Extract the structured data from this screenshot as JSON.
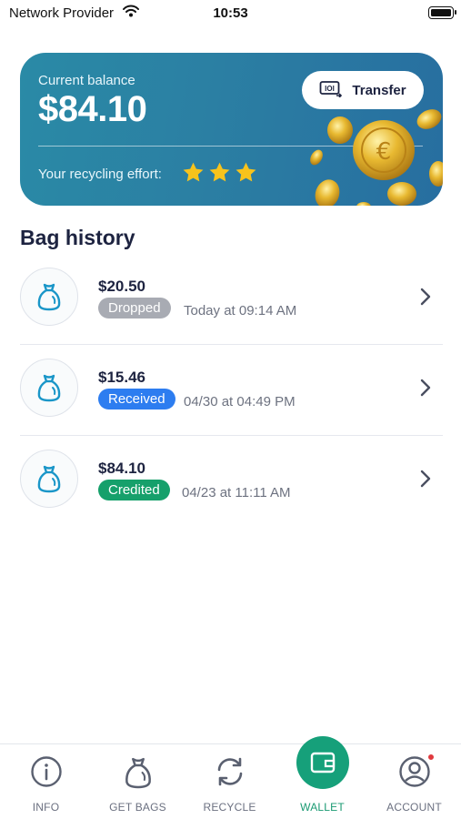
{
  "status_bar": {
    "carrier": "Network Provider",
    "time": "10:53"
  },
  "balance_card": {
    "label": "Current balance",
    "amount": "$84.10",
    "transfer_label": "Transfer",
    "effort_label": "Your recycling effort:",
    "effort_stars": 3
  },
  "history": {
    "title": "Bag history",
    "items": [
      {
        "amount": "$20.50",
        "status": "Dropped",
        "status_color": "#a8abb3",
        "date": "Today at 09:14 AM"
      },
      {
        "amount": "$15.46",
        "status": "Received",
        "status_color": "#2d7df0",
        "date": "04/30 at 04:49 PM"
      },
      {
        "amount": "$84.10",
        "status": "Credited",
        "status_color": "#16a06b",
        "date": "04/23 at 11:11 AM"
      }
    ]
  },
  "nav": {
    "items": [
      {
        "label": "INFO",
        "icon": "info-icon"
      },
      {
        "label": "GET BAGS",
        "icon": "bag-icon"
      },
      {
        "label": "RECYCLE",
        "icon": "recycle-icon"
      },
      {
        "label": "WALLET",
        "icon": "wallet-icon",
        "active": true
      },
      {
        "label": "ACCOUNT",
        "icon": "account-icon",
        "notification": true
      }
    ]
  },
  "colors": {
    "accent": "#16a07a",
    "card": "#2b80a3",
    "text": "#1d2340"
  }
}
